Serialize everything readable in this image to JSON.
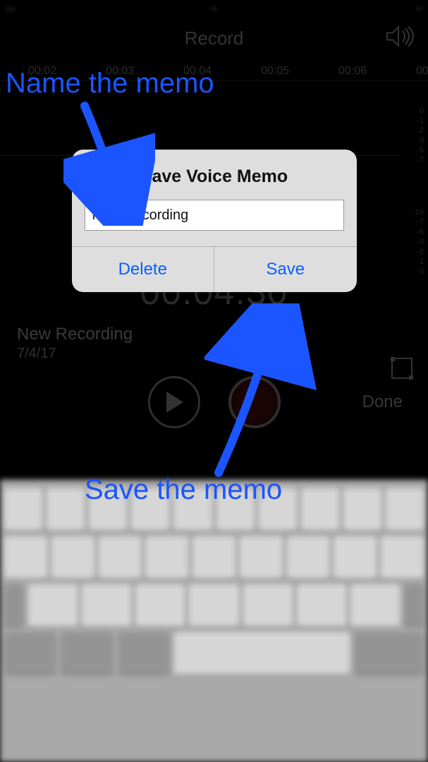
{
  "status": {
    "left": "•••",
    "center": "••",
    "right": "••"
  },
  "nav": {
    "title": "Record"
  },
  "timeline": {
    "ticks": [
      "00:02",
      "00:03",
      "00:04",
      "00:05",
      "00:06",
      "00"
    ],
    "positions": [
      40,
      150,
      260,
      370,
      480,
      590
    ]
  },
  "db_scale_upper": [
    "0",
    "-1",
    "-2",
    "-3",
    "-5",
    "-7"
  ],
  "db_scale_lower": [
    "-10",
    "-7",
    "-5",
    "-3",
    "-2",
    "-1",
    "0"
  ],
  "elapsed": "00:04.30",
  "recording": {
    "name": "New Recording",
    "date": "7/4/17"
  },
  "controls": {
    "done": "Done"
  },
  "dialog": {
    "title": "Save Voice Memo",
    "input_value": "New Recording",
    "delete_label": "Delete",
    "save_label": "Save"
  },
  "annotations": {
    "name_memo": "Name the memo",
    "save_memo": "Save the memo"
  },
  "colors": {
    "accent_blue": "#0a60ff",
    "annot_blue": "#1b55ff"
  }
}
